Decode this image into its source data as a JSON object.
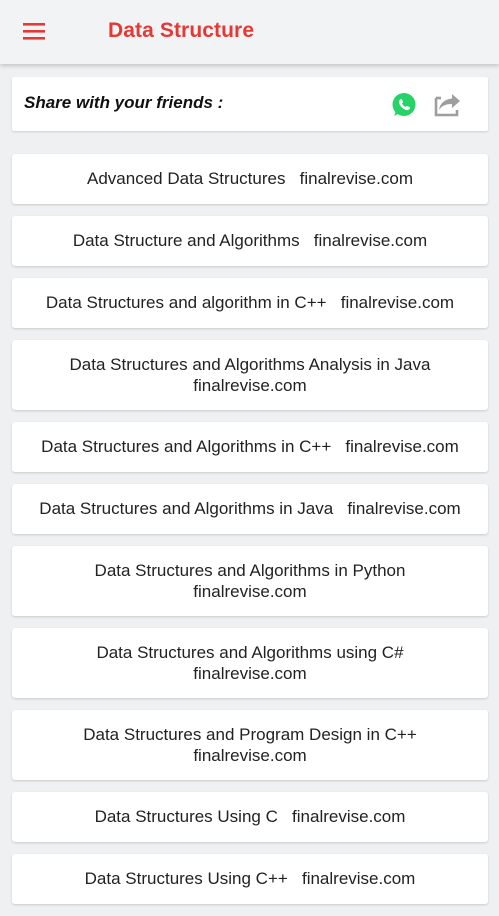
{
  "appbar": {
    "title": "Data Structure",
    "menu_icon": "hamburger-menu-icon",
    "accent": "#e53935"
  },
  "share": {
    "label": "Share with your friends :",
    "whatsapp_icon": "whatsapp-icon",
    "share_icon": "share-arrow-icon",
    "whatsapp_color": "#25d366"
  },
  "items": [
    {
      "text": "Advanced Data Structures   finalrevise.com",
      "lines": 1
    },
    {
      "text": "Data Structure and Algorithms   finalrevise.com",
      "lines": 1
    },
    {
      "text": "Data Structures and algorithm in C++   finalrevise.com",
      "lines": 1
    },
    {
      "text": "Data Structures and Algorithms Analysis in Java\nfinalrevise.com",
      "lines": 2
    },
    {
      "text": "Data Structures and Algorithms in C++   finalrevise.com",
      "lines": 1
    },
    {
      "text": "Data Structures and Algorithms in Java   finalrevise.com",
      "lines": 1
    },
    {
      "text": "Data Structures and Algorithms in Python\nfinalrevise.com",
      "lines": 2
    },
    {
      "text": "Data Structures and Algorithms using C#\nfinalrevise.com",
      "lines": 2
    },
    {
      "text": "Data Structures and Program Design in C++\nfinalrevise.com",
      "lines": 2
    },
    {
      "text": "Data Structures Using C   finalrevise.com",
      "lines": 1
    },
    {
      "text": "Data Structures Using C++   finalrevise.com",
      "lines": 1
    }
  ]
}
